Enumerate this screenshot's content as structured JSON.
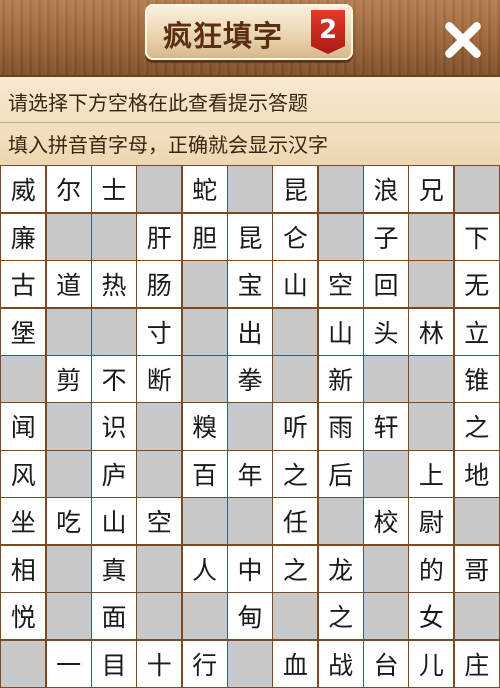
{
  "header": {
    "title": "疯狂填字",
    "level": "2",
    "close_icon": "close-x-icon"
  },
  "hints": {
    "line1": "请选择下方空格在此查看提示答题",
    "line2": "填入拼音首字母，正确就会显示汉字"
  },
  "colors": {
    "board_border": "#7a4a24",
    "blocked_cell": "#c8c8c8",
    "open_cell": "#ffffff"
  },
  "grid": [
    [
      "威",
      "尔",
      "士",
      "#",
      "蛇",
      "#",
      "昆",
      "#",
      "浪",
      "兄",
      "#"
    ],
    [
      "廉",
      "#",
      "#",
      "肝",
      "胆",
      "昆",
      "仑",
      "#",
      "子",
      "#",
      "下"
    ],
    [
      "古",
      "道",
      "热",
      "肠",
      "#",
      "宝",
      "山",
      "空",
      "回",
      "#",
      "无"
    ],
    [
      "堡",
      "#",
      "#",
      "寸",
      "#",
      "出",
      "#",
      "山",
      "头",
      "林",
      "立"
    ],
    [
      "#",
      "剪",
      "不",
      "断",
      "#",
      "拳",
      "#",
      "新",
      "#",
      "#",
      "锥"
    ],
    [
      "闻",
      "#",
      "识",
      "#",
      "糗",
      "#",
      "听",
      "雨",
      "轩",
      "#",
      "之"
    ],
    [
      "风",
      "#",
      "庐",
      "#",
      "百",
      "年",
      "之",
      "后",
      "#",
      "上",
      "地"
    ],
    [
      "坐",
      "吃",
      "山",
      "空",
      "#",
      "#",
      "任",
      "#",
      "校",
      "尉",
      "#"
    ],
    [
      "相",
      "#",
      "真",
      "#",
      "人",
      "中",
      "之",
      "龙",
      "#",
      "的",
      "哥"
    ],
    [
      "悦",
      "#",
      "面",
      "#",
      "#",
      "甸",
      "#",
      "之",
      "#",
      "女",
      "#"
    ],
    [
      "#",
      "一",
      "目",
      "十",
      "行",
      "#",
      "血",
      "战",
      "台",
      "儿",
      "庄"
    ]
  ]
}
